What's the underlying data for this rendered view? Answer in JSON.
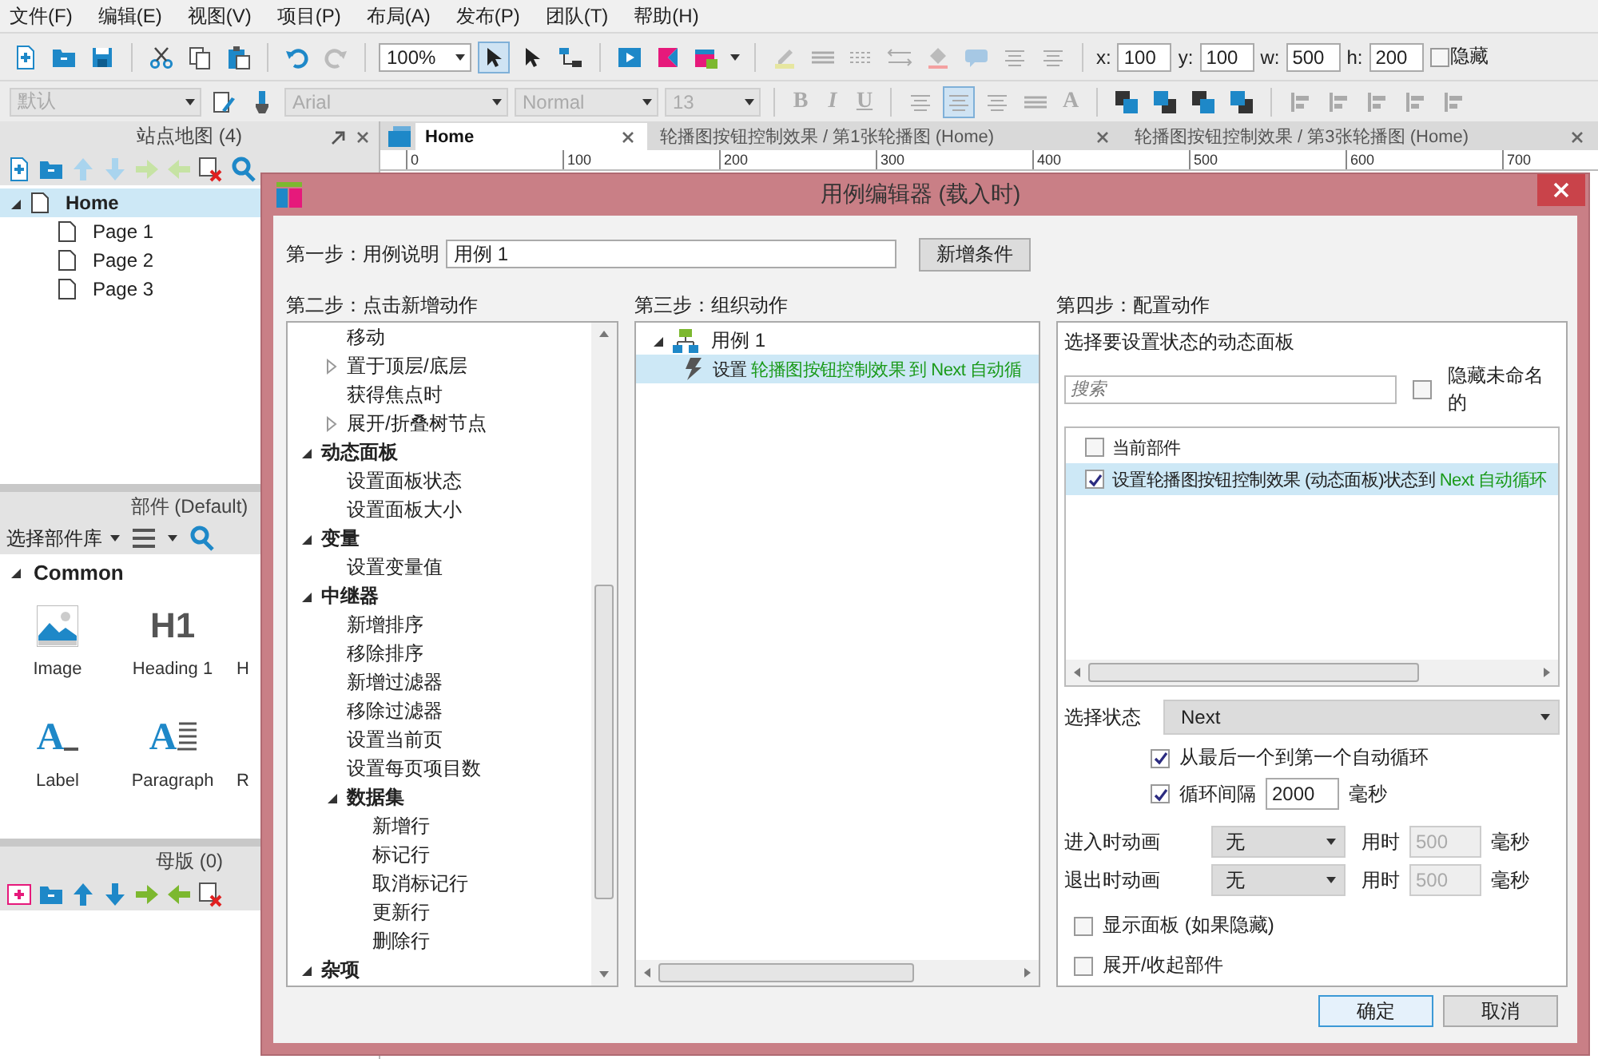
{
  "menu": [
    "文件(F)",
    "编辑(E)",
    "视图(V)",
    "项目(P)",
    "布局(A)",
    "发布(P)",
    "团队(T)",
    "帮助(H)"
  ],
  "toolbar": {
    "zoom": "100%",
    "fields": [
      {
        "label": "x:",
        "value": "100"
      },
      {
        "label": "y:",
        "value": "100"
      },
      {
        "label": "w:",
        "value": "500"
      },
      {
        "label": "h:",
        "value": "200"
      }
    ],
    "hidden": {
      "label": "隐藏",
      "checked": false
    }
  },
  "format_bar": {
    "style": "默认",
    "font": "Arial",
    "weight": "Normal",
    "size": "13",
    "text_buttons": [
      "B",
      "I",
      "U"
    ],
    "font_color": "A"
  },
  "sitemap": {
    "title": "站点地图 (4)",
    "pages": [
      {
        "label": "Home",
        "selected": true,
        "expanded": true,
        "children": [
          {
            "label": "Page 1",
            "selected": false
          },
          {
            "label": "Page 2",
            "selected": false
          },
          {
            "label": "Page 3",
            "selected": false
          }
        ]
      }
    ]
  },
  "widgets": {
    "title": "部件 (Default)",
    "library": "选择部件库",
    "group": "Common",
    "items": [
      {
        "label": "Image",
        "kind": "image"
      },
      {
        "label": "Heading 1",
        "kind": "heading",
        "glyph": "H1"
      },
      {
        "label": "H",
        "kind": "cut"
      },
      {
        "label": "Label",
        "kind": "label",
        "glyph": "A"
      },
      {
        "label": "Paragraph",
        "kind": "paragraph",
        "glyph": "A"
      },
      {
        "label": "R",
        "kind": "cut"
      }
    ]
  },
  "masters": {
    "title": "母版 (0)"
  },
  "canvas": {
    "tabs": [
      {
        "label": "Home",
        "selected": true
      },
      {
        "label": "轮播图按钮控制效果 / 第1张轮播图 (Home)",
        "selected": false
      },
      {
        "label": "轮播图按钮控制效果 / 第3张轮播图 (Home)",
        "selected": false
      }
    ],
    "ruler": [
      "0",
      "100",
      "200",
      "300",
      "400",
      "500",
      "600",
      "700"
    ]
  },
  "dialog": {
    "title": "用例编辑器 (载入时)",
    "step1": {
      "label": "第一步：用例说明",
      "value": "用例 1",
      "button": "新增条件"
    },
    "step2": {
      "label": "第二步：点击新增动作",
      "leading_items": [
        {
          "label": "移动"
        },
        {
          "label": "置于顶层/底层",
          "expanded": false
        },
        {
          "label": "获得焦点时"
        },
        {
          "label": "展开/折叠树节点",
          "expanded": false
        }
      ],
      "groups": [
        {
          "label": "动态面板",
          "expanded": true,
          "children": [
            {
              "label": "设置面板状态"
            },
            {
              "label": "设置面板大小"
            }
          ]
        },
        {
          "label": "变量",
          "expanded": true,
          "children": [
            {
              "label": "设置变量值"
            }
          ]
        },
        {
          "label": "中继器",
          "expanded": true,
          "children": [
            {
              "label": "新增排序"
            },
            {
              "label": "移除排序"
            },
            {
              "label": "新增过滤器"
            },
            {
              "label": "移除过滤器"
            },
            {
              "label": "设置当前页"
            },
            {
              "label": "设置每页项目数"
            },
            {
              "label": "数据集",
              "expanded": true,
              "children": [
                {
                  "label": "新增行"
                },
                {
                  "label": "标记行"
                },
                {
                  "label": "取消标记行"
                },
                {
                  "label": "更新行"
                },
                {
                  "label": "删除行"
                }
              ]
            }
          ]
        },
        {
          "label": "杂项",
          "expanded": true
        }
      ]
    },
    "step3": {
      "label": "第三步：组织动作",
      "case": {
        "label": "用例 1",
        "expanded": true,
        "actions": [
          {
            "verb": "设置",
            "target": "轮播图按钮控制效果 到 Next 自动循",
            "selected": true
          }
        ]
      }
    },
    "step4": {
      "label": "第四步：配置动作",
      "box_title": "选择要设置状态的动态面板",
      "search_placeholder": "搜索",
      "hide_unnamed": {
        "label": "隐藏未命名的",
        "checked": false
      },
      "panels": [
        {
          "label": "当前部件",
          "checked": false,
          "selected": false
        },
        {
          "label": "设置轮播图按钮控制效果 (动态面板)状态到",
          "state": "Next 自动循环",
          "checked": true,
          "selected": true
        }
      ],
      "state_label": "选择状态",
      "state_value": "Next",
      "wrap": {
        "label": "从最后一个到第一个自动循环",
        "checked": true
      },
      "repeat": {
        "label": "循环间隔",
        "checked": true,
        "value": "2000",
        "unit": "毫秒"
      },
      "animations": [
        {
          "label": "进入时动画",
          "value": "无",
          "duration_label": "用时",
          "duration": "500",
          "unit": "毫秒",
          "disabled": true
        },
        {
          "label": "退出时动画",
          "value": "无",
          "duration_label": "用时",
          "duration": "500",
          "unit": "毫秒",
          "disabled": true
        }
      ],
      "options": [
        {
          "label": "显示面板 (如果隐藏)",
          "checked": false
        },
        {
          "label": "展开/收起部件",
          "checked": false
        }
      ]
    },
    "buttons": [
      {
        "label": "确定",
        "default": true
      },
      {
        "label": "取消",
        "default": false
      }
    ]
  }
}
